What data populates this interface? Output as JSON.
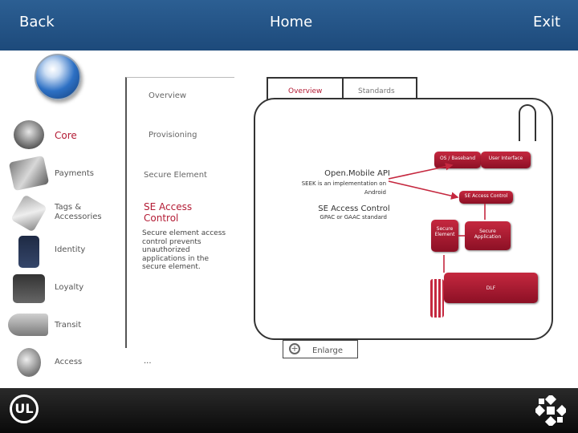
{
  "header": {
    "back": "Back",
    "home": "Home",
    "exit": "Exit"
  },
  "sidebar": {
    "items": [
      {
        "id": "core",
        "label": "Core"
      },
      {
        "id": "payments",
        "label": "Payments"
      },
      {
        "id": "tags",
        "label": "Tags &\nAccessories"
      },
      {
        "id": "identity",
        "label": "Identity"
      },
      {
        "id": "loyalty",
        "label": "Loyalty"
      },
      {
        "id": "transit",
        "label": "Transit"
      },
      {
        "id": "access",
        "label": "Access"
      }
    ]
  },
  "submenu": {
    "overview": "Overview",
    "provisioning": "Provisioning",
    "secure_element": "Secure Element",
    "se_access_control": "SE Access\nControl",
    "description": "Secure element access control prevents unauthorized applications in the secure element.",
    "ellipsis": "..."
  },
  "tabs": {
    "overview": "Overview",
    "standards": "Standards"
  },
  "diagram": {
    "os_baseband": "OS / Baseband",
    "user_interface": "User Interface",
    "se_access_control_box": "SE Access Control",
    "secure_element": "Secure\nElement",
    "secure_application": "Secure\nApplication",
    "dlf": "DLF",
    "open_mobile_api": "Open.Mobile API",
    "seek_note": "SEEK is an implementation on Android",
    "se_access_control": "SE Access Control",
    "gpac_note": "GPAC or GAAC standard"
  },
  "enlarge": {
    "label": "Enlarge"
  },
  "footer": {
    "ul_logo": "UL"
  },
  "colors": {
    "header": "#1d4a7b",
    "accent": "#b31b34",
    "box": "#c5283f",
    "footer": "#111111"
  }
}
